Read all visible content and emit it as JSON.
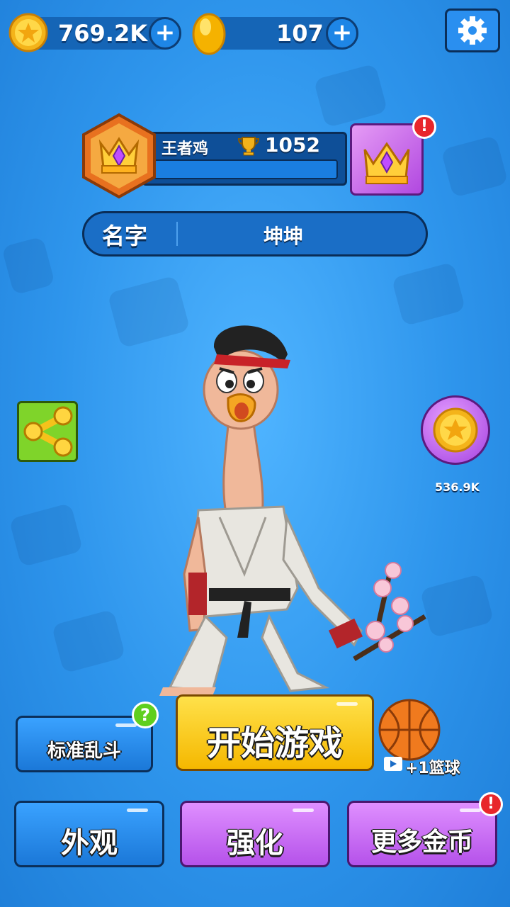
{
  "hud": {
    "stars_value": "769.2K",
    "gems_value": "107",
    "plus_label": "+"
  },
  "rank": {
    "title": "王者鸡",
    "trophies": "1052"
  },
  "name_bar": {
    "label": "名字",
    "value": "坤坤"
  },
  "side": {
    "coin_reward": "536.9K"
  },
  "buttons": {
    "mode": "标准乱斗",
    "mode_help": "?",
    "start": "开始游戏",
    "ball_reward": "+1篮球",
    "appearance": "外观",
    "upgrade": "强化",
    "more_coins": "更多金币",
    "alert": "!"
  },
  "colors": {
    "bg": "#2e95ec",
    "start_button": "#ffd21e",
    "blue_button": "#2a8ff0",
    "purple_button": "#c86bf0",
    "alert": "#e8262b"
  }
}
